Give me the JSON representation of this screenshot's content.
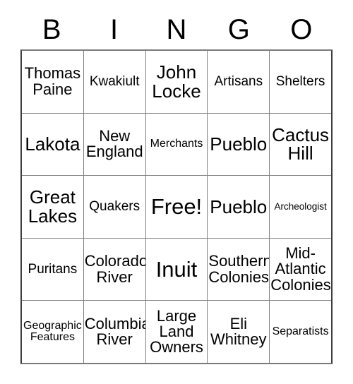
{
  "card": {
    "headers": [
      "B",
      "I",
      "N",
      "G",
      "O"
    ],
    "rows": [
      [
        {
          "text": "Thomas Paine",
          "size": "fs-l"
        },
        {
          "text": "Kwakiult",
          "size": "fs-m"
        },
        {
          "text": "John Locke",
          "size": "fs-xl"
        },
        {
          "text": "Artisans",
          "size": "fs-m"
        },
        {
          "text": "Shelters",
          "size": "fs-m"
        }
      ],
      [
        {
          "text": "Lakota",
          "size": "fs-xl"
        },
        {
          "text": "New England",
          "size": "fs-l"
        },
        {
          "text": "Merchants",
          "size": "fs-s"
        },
        {
          "text": "Pueblo",
          "size": "fs-xl"
        },
        {
          "text": "Cactus Hill",
          "size": "fs-xl"
        }
      ],
      [
        {
          "text": "Great Lakes",
          "size": "fs-xl"
        },
        {
          "text": "Quakers",
          "size": "fs-m"
        },
        {
          "text": "Free!",
          "size": "fs-xxl"
        },
        {
          "text": "Pueblo",
          "size": "fs-xl"
        },
        {
          "text": "Archeologist",
          "size": "fs-xs"
        }
      ],
      [
        {
          "text": "Puritans",
          "size": "fs-m"
        },
        {
          "text": "Colorado River",
          "size": "fs-l"
        },
        {
          "text": "Inuit",
          "size": "fs-xxl"
        },
        {
          "text": "Southern Colonies",
          "size": "fs-l"
        },
        {
          "text": "Mid-Atlantic Colonies",
          "size": "fs-l"
        }
      ],
      [
        {
          "text": "Geographic Features",
          "size": "fs-s"
        },
        {
          "text": "Columbia River",
          "size": "fs-l"
        },
        {
          "text": "Large Land Owners",
          "size": "fs-l"
        },
        {
          "text": "Eli Whitney",
          "size": "fs-l"
        },
        {
          "text": "Separatists",
          "size": "fs-s"
        }
      ]
    ]
  },
  "colors": {
    "background": "#ffffff",
    "text": "#000000",
    "grid_line": "#808080",
    "outer_border": "#3d3d3d"
  }
}
